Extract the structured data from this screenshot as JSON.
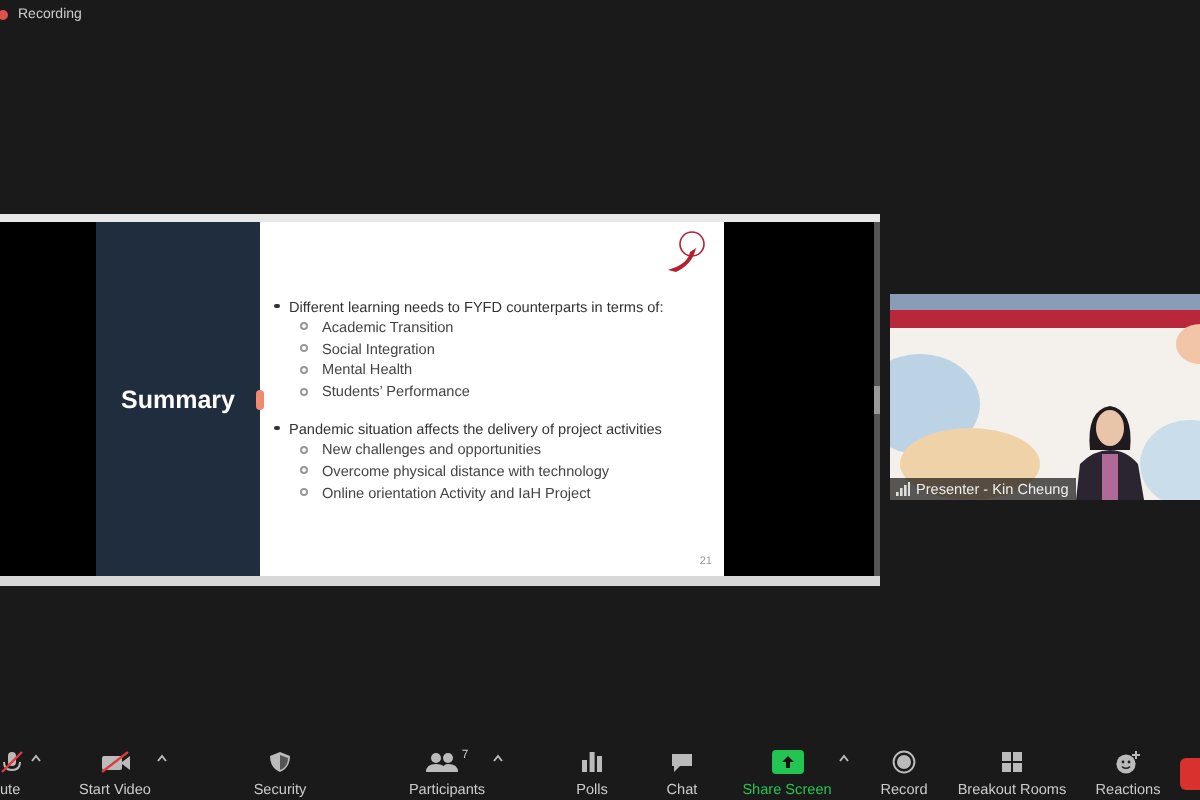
{
  "recording": {
    "label": "Recording"
  },
  "shared_screen": {
    "slide": {
      "title": "Summary",
      "page_number": "21",
      "bullets": [
        {
          "text": "Different learning needs to FYFD counterparts in terms of:",
          "children": [
            {
              "text": "Academic Transition"
            },
            {
              "text": "Social Integration"
            },
            {
              "text": "Mental Health"
            },
            {
              "text": "Students’ Performance"
            }
          ]
        },
        {
          "text": "Pandemic situation affects the delivery of project activities",
          "children": [
            {
              "text": "New challenges and opportunities"
            },
            {
              "text": "Overcome physical distance with technology"
            },
            {
              "text": "Online orientation Activity and IaH Project"
            }
          ]
        }
      ]
    }
  },
  "video_tile": {
    "name": "Presenter - Kin Cheung"
  },
  "toolbar": [
    {
      "kind": "mute",
      "label": "ute",
      "caret": true
    },
    {
      "kind": "video",
      "label": "Start Video",
      "caret": true
    },
    {
      "kind": "security",
      "label": "Security",
      "caret": false
    },
    {
      "kind": "participants",
      "label": "Participants",
      "count": "7",
      "caret": true
    },
    {
      "kind": "polls",
      "label": "Polls",
      "caret": false
    },
    {
      "kind": "chat",
      "label": "Chat",
      "caret": false
    },
    {
      "kind": "share",
      "label": "Share Screen",
      "caret": true
    },
    {
      "kind": "record",
      "label": "Record",
      "caret": false
    },
    {
      "kind": "breakout",
      "label": "Breakout Rooms",
      "caret": false
    },
    {
      "kind": "reactions",
      "label": "Reactions",
      "caret": false
    }
  ]
}
